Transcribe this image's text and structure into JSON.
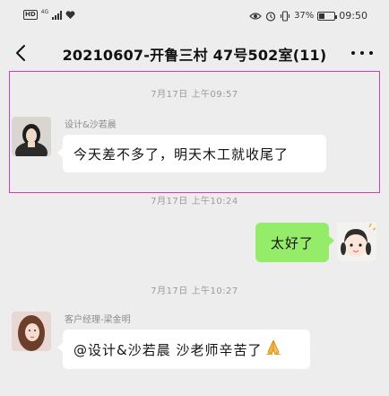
{
  "status_bar": {
    "hd": "HD",
    "network": "4G",
    "battery": "37%",
    "battery_level": 0.37,
    "time": "09:50"
  },
  "nav": {
    "title": "20210607-开鲁三村 47号502室(11)"
  },
  "messages": [
    {
      "timestamp": "7月17日 上午09:57",
      "sender": "设计&沙若晨",
      "text": "今天差不多了，明天木工就收尾了",
      "side": "left"
    },
    {
      "timestamp": "7月17日 上午10:24",
      "text": "太好了",
      "side": "right"
    },
    {
      "timestamp": "7月17日 上午10:27",
      "sender": "客户经理-梁金明",
      "text": "@设计&沙若晨 沙老师辛苦了",
      "emoji": "🙏",
      "side": "left"
    }
  ],
  "colors": {
    "background": "#ededed",
    "bubble_self": "#95ec69",
    "bubble_other": "#ffffff",
    "highlight": "#d33cb5"
  }
}
